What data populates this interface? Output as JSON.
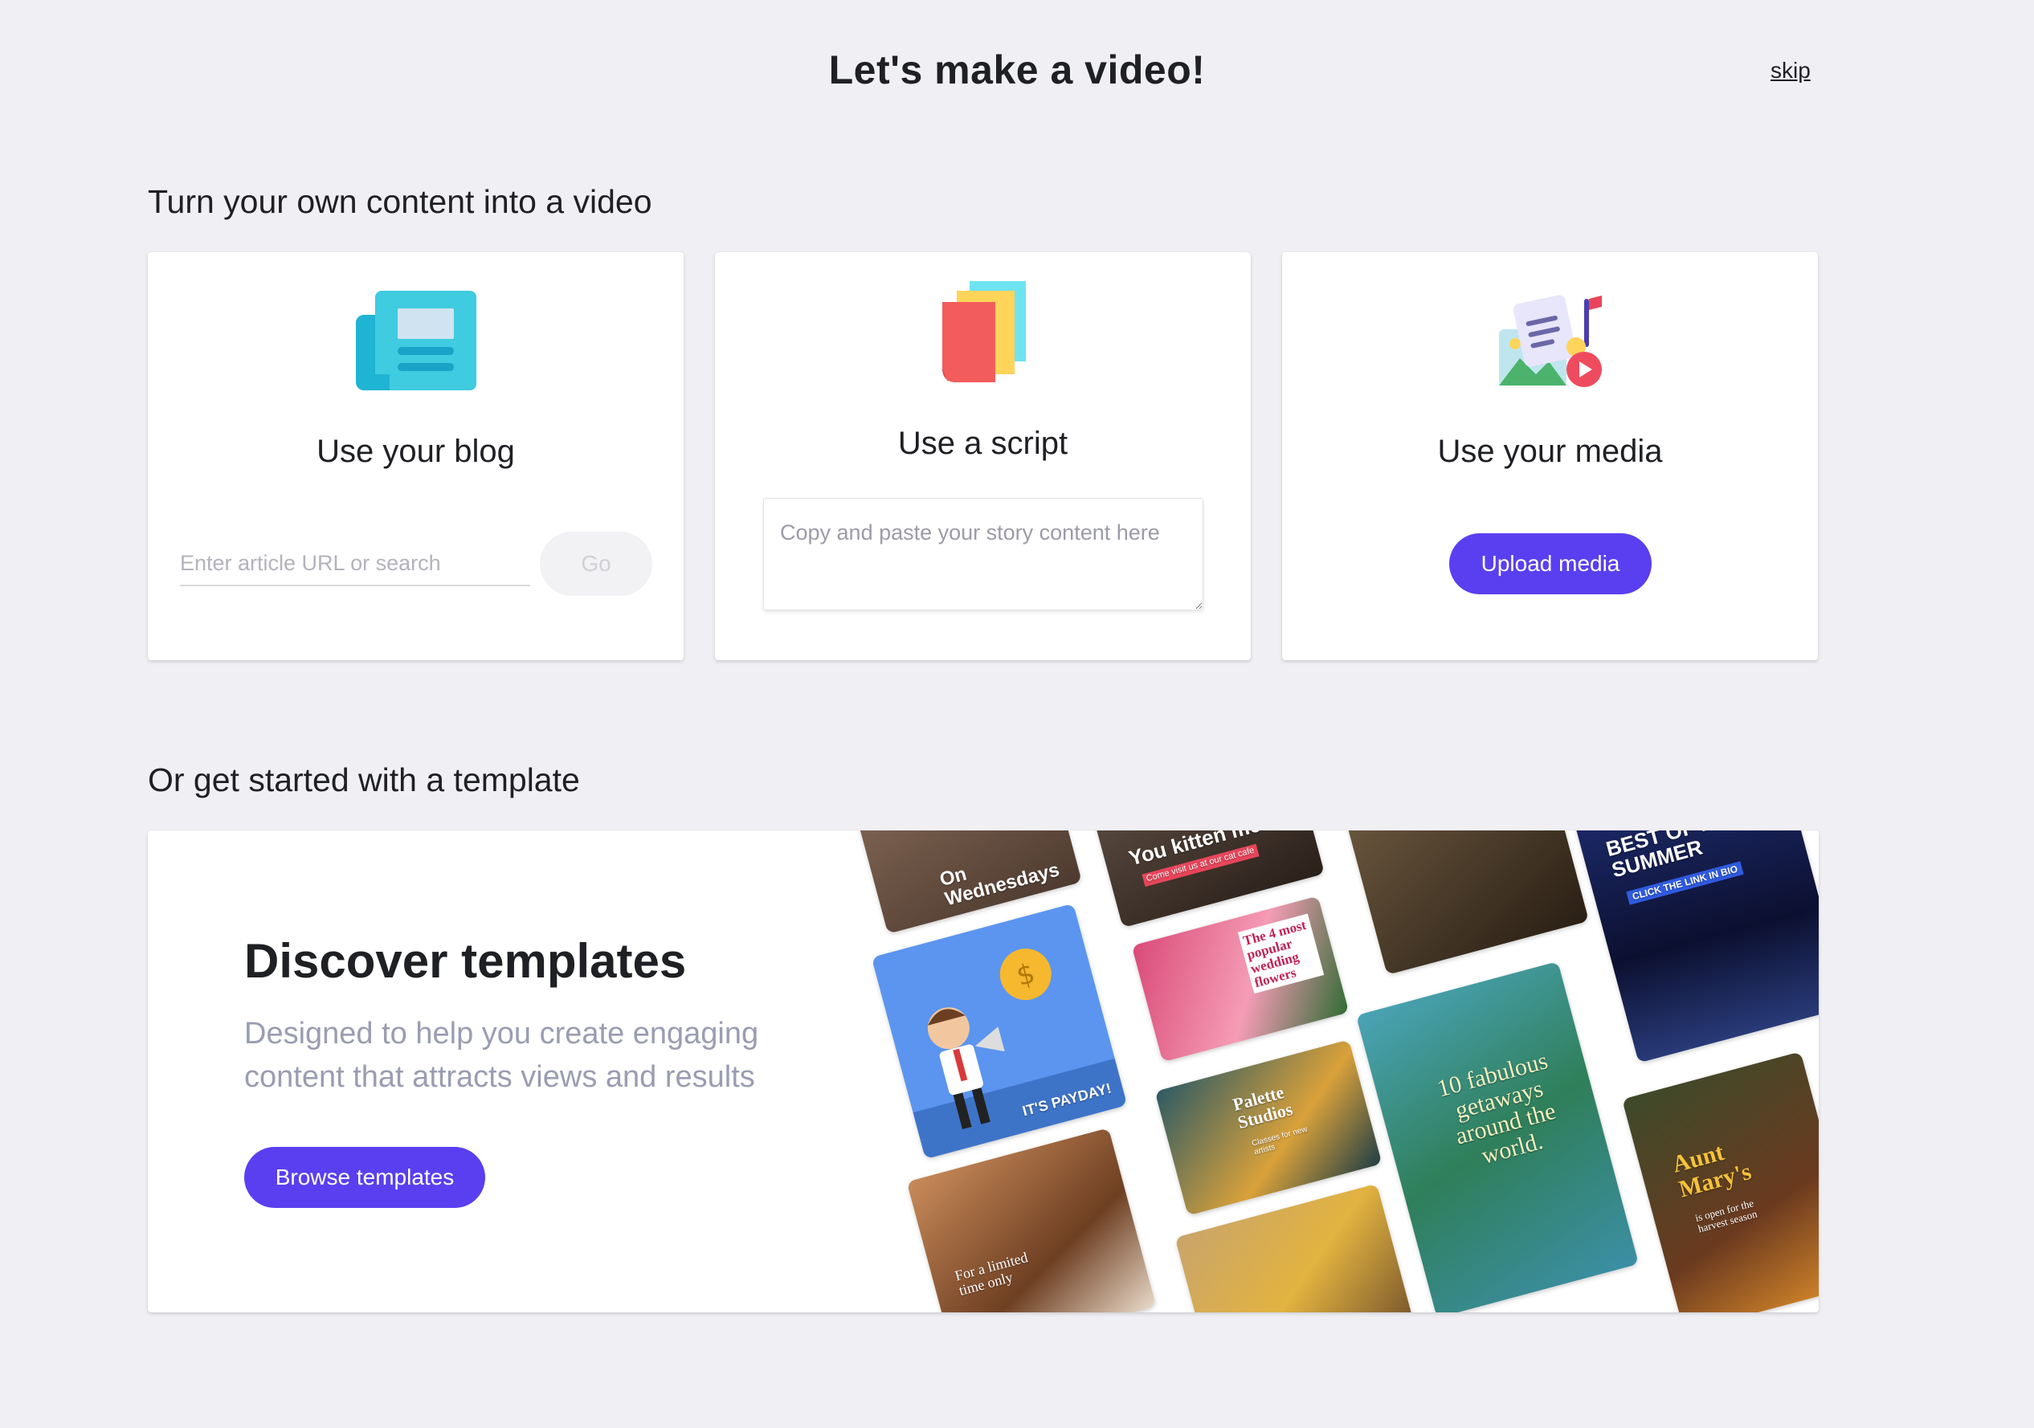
{
  "header": {
    "title": "Let's make a video!",
    "skip_label": "skip"
  },
  "own_content": {
    "section_title": "Turn your own content into a video",
    "blog": {
      "title": "Use your blog",
      "input_placeholder": "Enter article URL or search",
      "go_label": "Go",
      "icon": "newspaper-icon"
    },
    "script": {
      "title": "Use a script",
      "textarea_placeholder": "Copy and paste your story content here",
      "icon": "stacked-pages-icon"
    },
    "media": {
      "title": "Use your media",
      "upload_label": "Upload media",
      "icon": "media-collage-icon"
    }
  },
  "templates": {
    "section_title": "Or get started with a template",
    "heading": "Discover templates",
    "subtitle": "Designed to help you create engaging content that attracts views and results",
    "browse_label": "Browse templates",
    "tiles": [
      {
        "name": "wednesdays",
        "text": "On Wednesdays"
      },
      {
        "name": "kitten",
        "text": "You kitten me?",
        "subtext": "Come visit us at our cat cafe"
      },
      {
        "name": "summer",
        "text": "BEST OF FOR SUMMER",
        "subtext": "CLICK THE LINK IN BIO"
      },
      {
        "name": "payday",
        "text": "IT'S PAYDAY!"
      },
      {
        "name": "flowers",
        "text": "The 4 most popular wedding flowers"
      },
      {
        "name": "palette",
        "text": "Palette Studios",
        "subtext": "Classes for new artists"
      },
      {
        "name": "getaways",
        "text": "10 fabulous getaways around the world."
      },
      {
        "name": "limited",
        "text": "For a limited time only"
      },
      {
        "name": "aunt-marys",
        "text": "Aunt Mary's",
        "subtext": "is open for the harvest season"
      }
    ]
  },
  "colors": {
    "accent": "#5a3ff0",
    "background": "#f0f0f4",
    "card": "#ffffff"
  }
}
